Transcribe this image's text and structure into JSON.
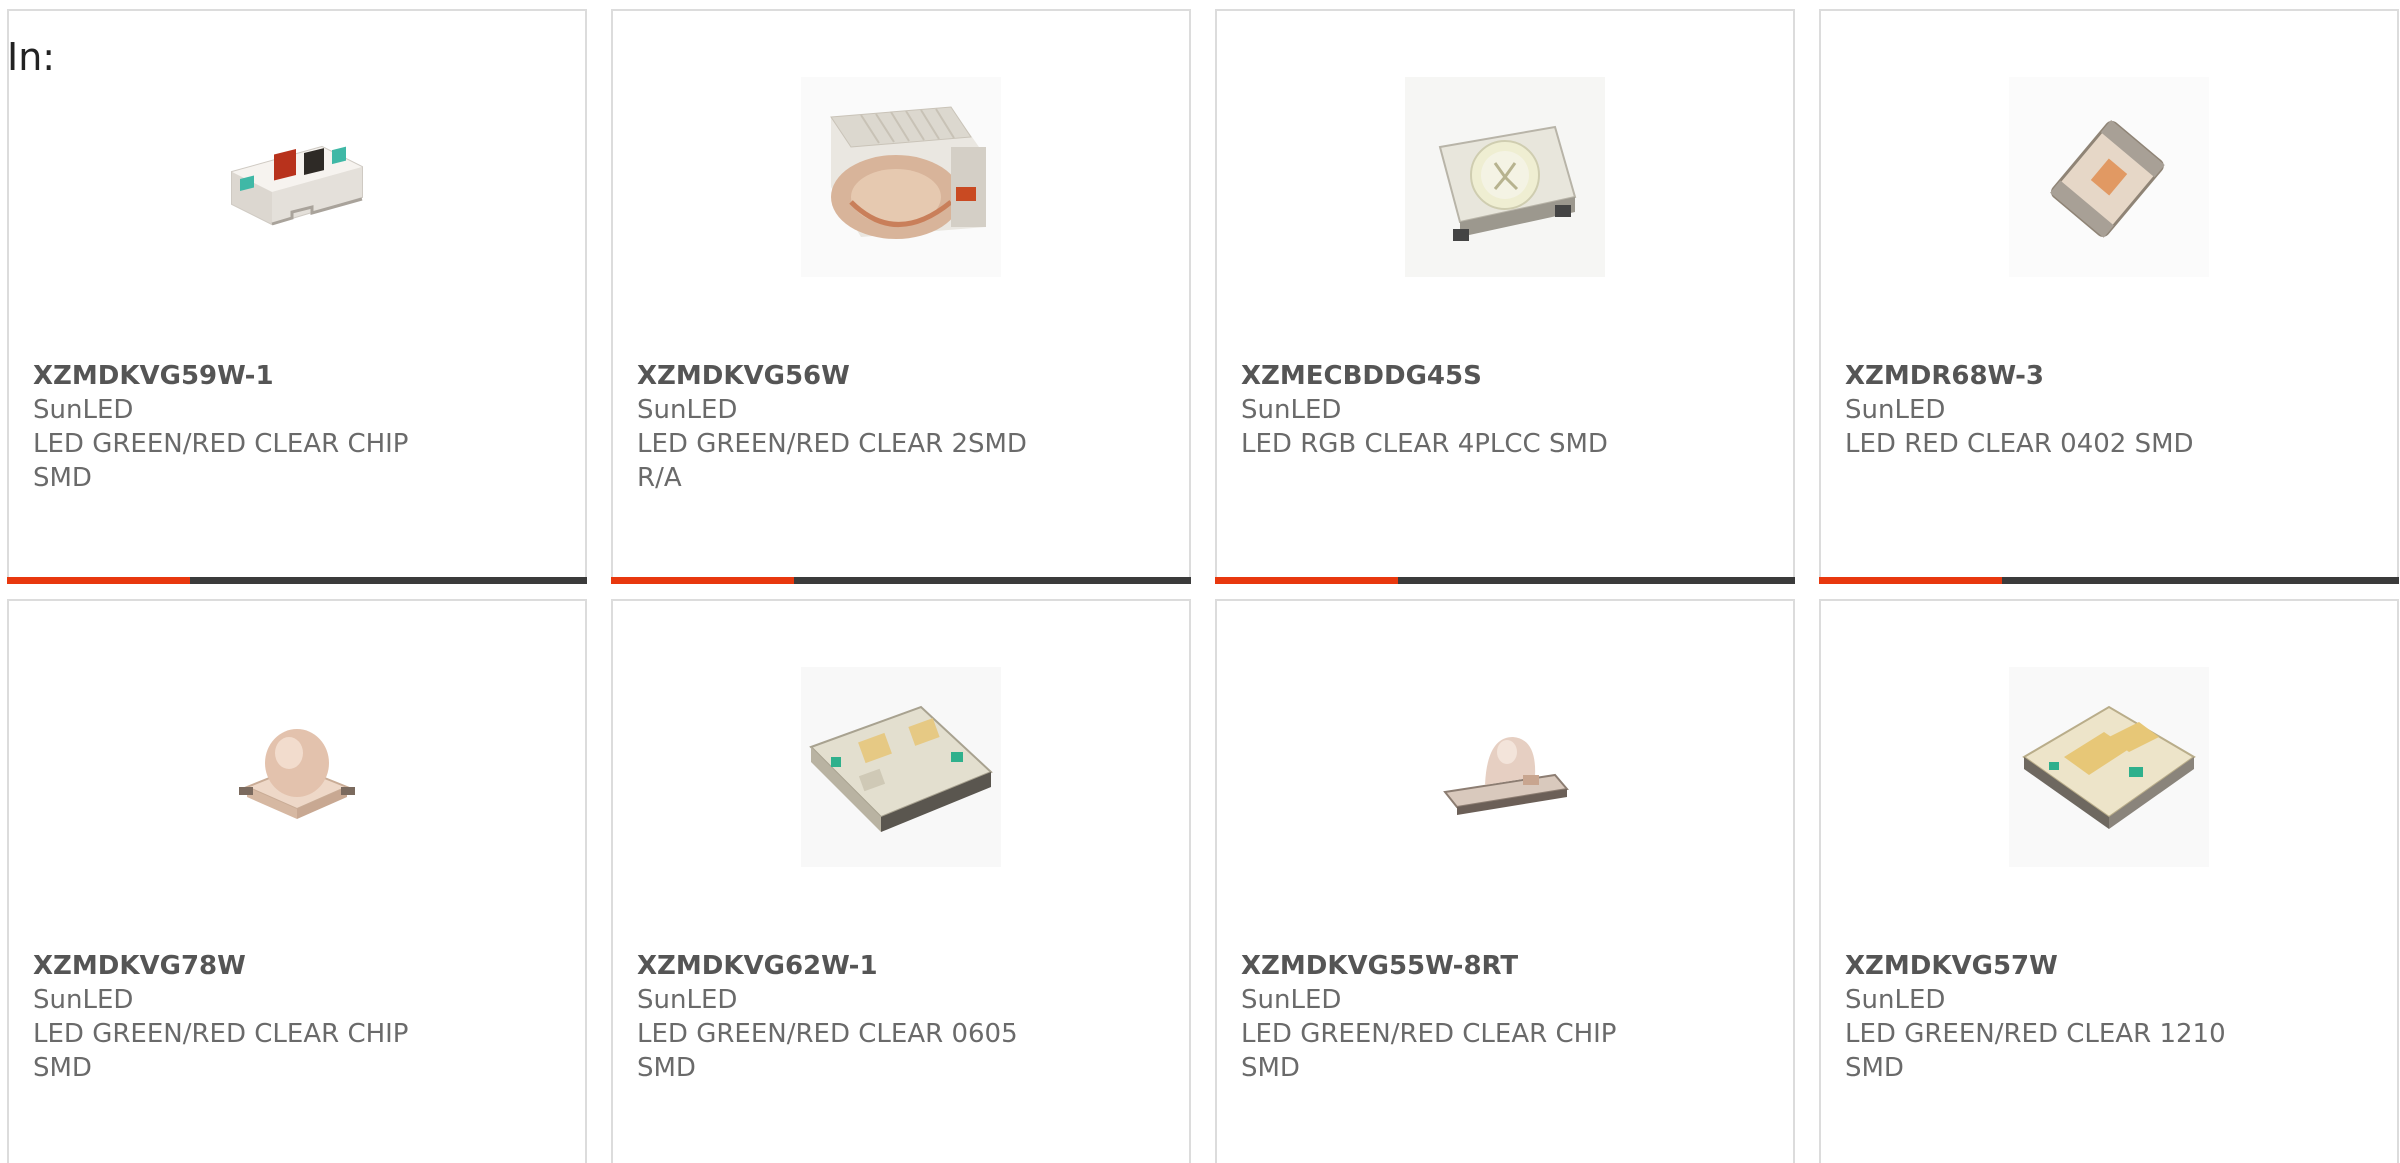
{
  "header": {
    "in_label": "In:"
  },
  "colors": {
    "accent": "#e8380e",
    "bar": "#3b3b3b",
    "text": "#6a6a6a",
    "border": "#dcdcdc"
  },
  "products": [
    {
      "part_number": "XZMDKVG59W-1",
      "manufacturer": "SunLED",
      "description": "LED GREEN/RED CLEAR CHIP SMD",
      "image_icon": "bicolor-chip-led-icon"
    },
    {
      "part_number": "XZMDKVG56W",
      "manufacturer": "SunLED",
      "description": "LED GREEN/RED CLEAR 2SMD R/A",
      "image_icon": "right-angle-led-icon"
    },
    {
      "part_number": "XZMECBDDG45S",
      "manufacturer": "SunLED",
      "description": "LED RGB CLEAR 4PLCC SMD",
      "image_icon": "plcc-led-icon"
    },
    {
      "part_number": "XZMDR68W-3",
      "manufacturer": "SunLED",
      "description": "LED RED CLEAR 0402 SMD",
      "image_icon": "small-chip-led-icon"
    },
    {
      "part_number": "XZMDKVG78W",
      "manufacturer": "SunLED",
      "description": "LED GREEN/RED CLEAR CHIP SMD",
      "image_icon": "dome-led-icon"
    },
    {
      "part_number": "XZMDKVG62W-1",
      "manufacturer": "SunLED",
      "description": "LED GREEN/RED CLEAR 0605 SMD",
      "image_icon": "clear-chip-led-icon"
    },
    {
      "part_number": "XZMDKVG55W-8RT",
      "manufacturer": "SunLED",
      "description": "LED GREEN/RED CLEAR CHIP SMD",
      "image_icon": "side-dome-led-icon"
    },
    {
      "part_number": "XZMDKVG57W",
      "manufacturer": "SunLED",
      "description": "LED GREEN/RED CLEAR 1210 SMD",
      "image_icon": "square-chip-led-icon"
    }
  ]
}
